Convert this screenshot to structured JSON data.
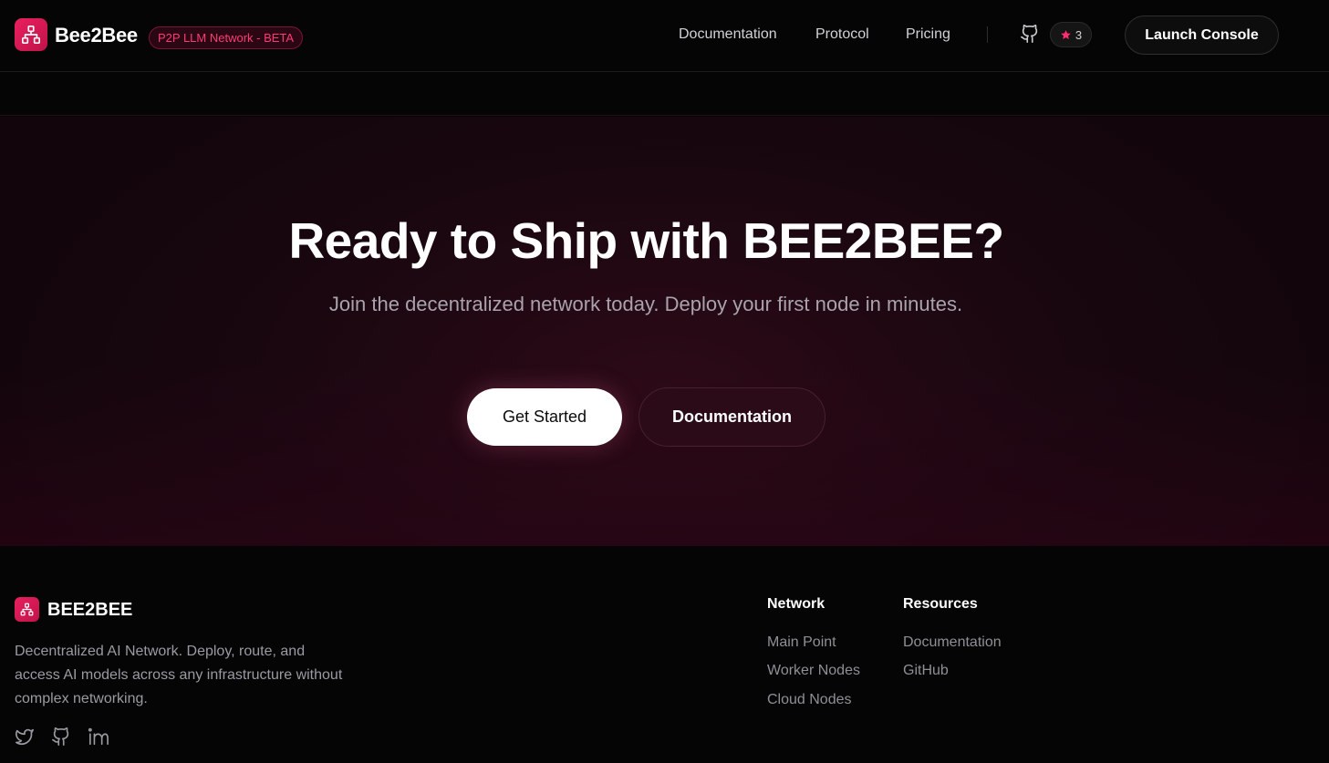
{
  "header": {
    "brand": "Bee2Bee",
    "badge": "P2P LLM Network - BETA",
    "nav": [
      "Documentation",
      "Protocol",
      "Pricing"
    ],
    "github_stars": "3",
    "launch_label": "Launch Console",
    "icons": {
      "logo": "network-icon",
      "github": "github-icon",
      "star": "star-icon"
    }
  },
  "hero": {
    "title": "Ready to Ship with BEE2BEE?",
    "subtitle": "Join the decentralized network today. Deploy your first node in minutes.",
    "primary_cta": "Get Started",
    "secondary_cta": "Documentation"
  },
  "footer": {
    "brand": "BEE2BEE",
    "description": "Decentralized AI Network. Deploy, route, and access AI models across any infrastructure without complex networking.",
    "social": [
      "twitter-icon",
      "github-icon",
      "linkedin-icon"
    ],
    "columns": [
      {
        "heading": "Network",
        "links": [
          "Main Point",
          "Worker Nodes",
          "Cloud Nodes"
        ]
      },
      {
        "heading": "Resources",
        "links": [
          "Documentation",
          "GitHub"
        ]
      }
    ]
  },
  "colors": {
    "accent": "#e8205f",
    "badge_text": "#ff3b77",
    "background": "#050505",
    "hero_background": "#1a0710"
  }
}
